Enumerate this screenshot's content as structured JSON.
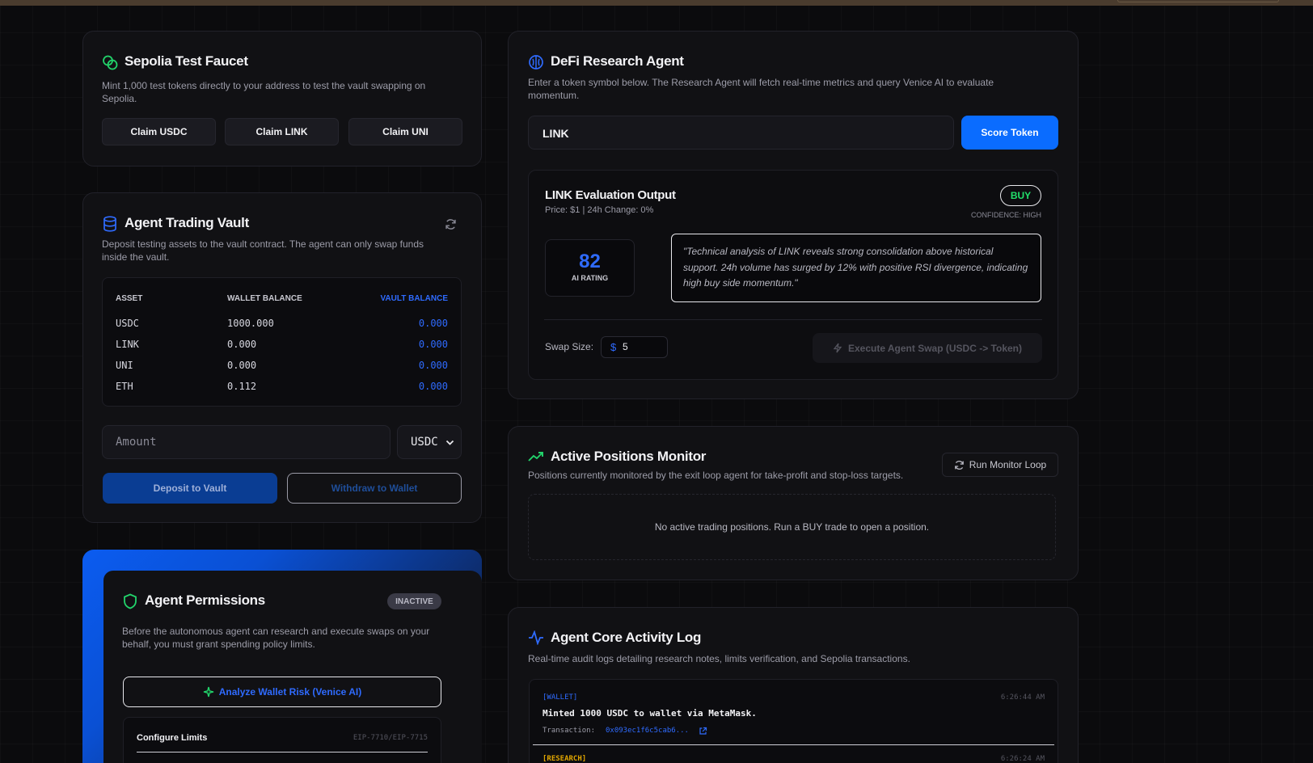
{
  "faucet": {
    "title": "Sepolia Test Faucet",
    "desc": "Mint 1,000 test tokens directly to your address to test the vault swapping on Sepolia.",
    "buttons": [
      "Claim USDC",
      "Claim LINK",
      "Claim UNI"
    ]
  },
  "vault": {
    "title": "Agent Trading Vault",
    "desc": "Deposit testing assets to the vault contract. The agent can only swap funds inside the vault.",
    "headers": [
      "ASSET",
      "WALLET BALANCE",
      "VAULT BALANCE"
    ],
    "rows": [
      {
        "asset": "USDC",
        "wallet": "1000.000",
        "vault": "0.000"
      },
      {
        "asset": "LINK",
        "wallet": "0.000",
        "vault": "0.000"
      },
      {
        "asset": "UNI",
        "wallet": "0.000",
        "vault": "0.000"
      },
      {
        "asset": "ETH",
        "wallet": "0.112",
        "vault": "0.000"
      }
    ],
    "amount_placeholder": "Amount",
    "asset_select": "USDC",
    "deposit_label": "Deposit to Vault",
    "withdraw_label": "Withdraw to Wallet"
  },
  "permissions": {
    "title": "Agent Permissions",
    "status": "INACTIVE",
    "desc": "Before the autonomous agent can research and execute swaps on your behalf, you must grant spending policy limits.",
    "analyze_label": "Analyze Wallet Risk (Venice AI)",
    "configure_label": "Configure Limits",
    "standard": "EIP-7710/EIP-7715"
  },
  "research": {
    "title": "DeFi Research Agent",
    "desc": "Enter a token symbol below. The Research Agent will fetch real-time metrics and query Venice AI to evaluate momentum.",
    "token_input": "LINK",
    "score_label": "Score Token",
    "output_title": "LINK Evaluation Output",
    "price_line": "Price: $1 | 24h Change: 0%",
    "verdict": "BUY",
    "confidence": "CONFIDENCE: HIGH",
    "rating": "82",
    "rating_label": "AI RATING",
    "analysis": "\"Technical analysis of LINK reveals strong consolidation above historical support. 24h volume has surged by 12% with positive RSI divergence, indicating high buy side momentum.\"",
    "swap_size_label": "Swap Size:",
    "swap_currency": "$",
    "swap_value": "5",
    "execute_label": "Execute Agent Swap (USDC -> Token)"
  },
  "positions": {
    "title": "Active Positions Monitor",
    "desc": "Positions currently monitored by the exit loop agent for take-profit and stop-loss targets.",
    "run_label": "Run Monitor Loop",
    "empty": "No active trading positions. Run a BUY trade to open a position."
  },
  "log": {
    "title": "Agent Core Activity Log",
    "desc": "Real-time audit logs detailing research notes, limits verification, and Sepolia transactions.",
    "entries": [
      {
        "tag": "[WALLET]",
        "time": "6:26:44 AM",
        "message": "Minted 1000 USDC to wallet via MetaMask.",
        "tx_label": "Transaction:",
        "tx": "0x093ec1f6c5cab6..."
      },
      {
        "tag": "[RESEARCH]",
        "time": "6:26:24 AM"
      }
    ]
  },
  "colors": {
    "accent": "#0a6cff",
    "buy": "#22e06b",
    "research_tag": "#e0a500"
  }
}
